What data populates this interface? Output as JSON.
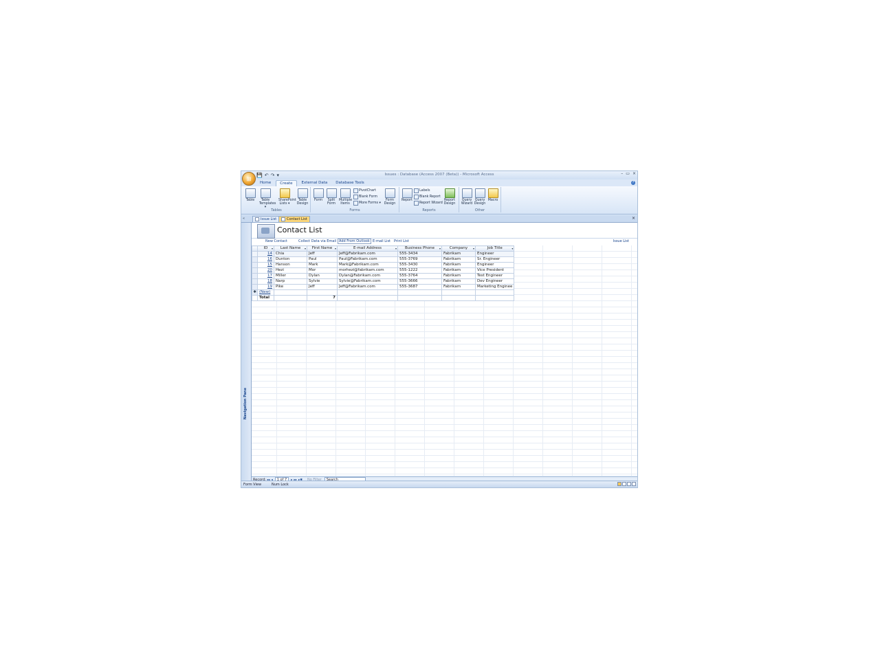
{
  "window": {
    "title": "Issues : Database (Access 2007 (Beta)) - Microsoft Access",
    "office_button_icon": "office-logo-icon",
    "qat_glyphs": [
      "💾",
      "↶",
      "↷",
      "▾"
    ],
    "controls": [
      "–",
      "▭",
      "×"
    ],
    "help_glyph": "?"
  },
  "ribbon": {
    "tabs": [
      "Home",
      "Create",
      "External Data",
      "Database Tools"
    ],
    "active_tab": "Create",
    "groups": {
      "tables": {
        "label": "Tables",
        "buttons": [
          "Table",
          "Table Templates ▾",
          "SharePoint Lists ▾",
          "Table Design"
        ]
      },
      "forms": {
        "label": "Forms",
        "buttons": [
          "Form",
          "Split Form",
          "Multiple Items"
        ],
        "small": [
          "PivotChart",
          "Blank Form",
          "More Forms ▾"
        ],
        "design": "Form Design"
      },
      "reports": {
        "label": "Reports",
        "buttons": [
          "Report"
        ],
        "small": [
          "Labels",
          "Blank Report",
          "Report Wizard"
        ],
        "design": "Report Design"
      },
      "other": {
        "label": "Other",
        "buttons": [
          "Query Wizard",
          "Query Design",
          "Macro"
        ]
      }
    }
  },
  "doc_tabs": {
    "shutter": "«",
    "tabs": [
      "Issue List",
      "Contact List"
    ],
    "active": "Contact List",
    "close": "×"
  },
  "nav_pane": {
    "label": "Navigation Pane"
  },
  "form": {
    "title": "Contact List",
    "commands": [
      "New Contact",
      "Collect Data via Email",
      "Add From Outlook",
      "E-mail List",
      "Print List"
    ],
    "right_command": "Issue List"
  },
  "grid": {
    "columns": [
      "ID",
      "Last Name",
      "First Name",
      "E-mail Address",
      "Business Phone",
      "Company",
      "Job Title"
    ],
    "rows": [
      [
        "14",
        "Chia",
        "Jeff",
        "Jeff@Fabrikam.com",
        "555-3434",
        "Fabrikam",
        "Engineer"
      ],
      [
        "16",
        "Dunton",
        "Paul",
        "Paul@Fabrikam.com",
        "555-3769",
        "Fabrikam",
        "Sr. Engineer"
      ],
      [
        "15",
        "Hanson",
        "Mark",
        "Mark@Fabrikam.com",
        "555-3430",
        "Fabrikam",
        "Engineer"
      ],
      [
        "20",
        "Hezi",
        "Mor",
        "morhezi@fabrikam.com",
        "555-1222",
        "Fabrikam",
        "Vice President"
      ],
      [
        "17",
        "Miller",
        "Dylan",
        "Dylan@Fabrikam.com",
        "555-3764",
        "Fabrikam",
        "Test Engineer"
      ],
      [
        "18",
        "Narp",
        "Sylvie",
        "Sylvie@Fabrikam.com",
        "555-3666",
        "Fabrikam",
        "Dev Engineer"
      ],
      [
        "19",
        "Pike",
        "Jeff",
        "Jeff@Fabrikam.com",
        "555-3687",
        "Fabrikam",
        "Marketing Enginee"
      ]
    ],
    "new_row_marker": "✱",
    "new_label": "(New)",
    "total_label": "Total",
    "total_first_name": "7"
  },
  "record_nav": {
    "label": "Record:",
    "position": "1 of 7",
    "glyphs": [
      "◂◂",
      "◂",
      "▸",
      "▸▸",
      "▸✱"
    ],
    "filter": "No Filter",
    "search": "Search"
  },
  "status": {
    "view": "Form View",
    "lock": "Num Lock"
  }
}
